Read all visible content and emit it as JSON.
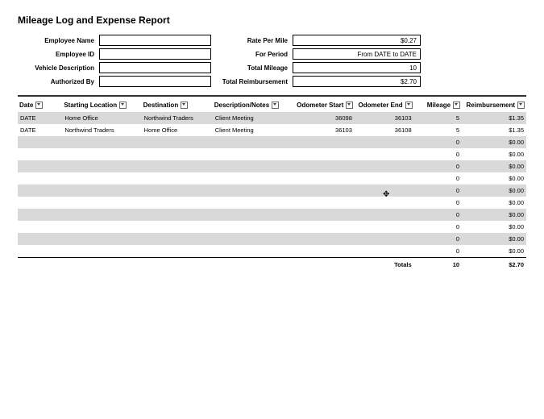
{
  "title": "Mileage Log and Expense Report",
  "header": {
    "left": [
      {
        "label": "Employee Name",
        "value": ""
      },
      {
        "label": "Employee ID",
        "value": ""
      },
      {
        "label": "Vehicle Description",
        "value": ""
      },
      {
        "label": "Authorized By",
        "value": ""
      }
    ],
    "right": [
      {
        "label": "Rate Per Mile",
        "value": "$0.27"
      },
      {
        "label": "For Period",
        "value": "From DATE to DATE"
      },
      {
        "label": "Total Mileage",
        "value": "10"
      },
      {
        "label": "Total Reimbursement",
        "value": "$2.70"
      }
    ]
  },
  "columns": [
    "Date",
    "Starting Location",
    "Destination",
    "Description/Notes",
    "Odometer Start",
    "Odometer End",
    "Mileage",
    "Reimbursement"
  ],
  "rows": [
    {
      "date": "DATE",
      "start": "Home Office",
      "dest": "Northwind Traders",
      "desc": "Client Meeting",
      "ostart": "36098",
      "oend": "36103",
      "mileage": "5",
      "reimb": "$1.35",
      "band": true
    },
    {
      "date": "DATE",
      "start": "Northwind Traders",
      "dest": "Home Office",
      "desc": "Client Meeting",
      "ostart": "36103",
      "oend": "36108",
      "mileage": "5",
      "reimb": "$1.35",
      "band": false
    },
    {
      "date": "",
      "start": "",
      "dest": "",
      "desc": "",
      "ostart": "",
      "oend": "",
      "mileage": "0",
      "reimb": "$0.00",
      "band": true
    },
    {
      "date": "",
      "start": "",
      "dest": "",
      "desc": "",
      "ostart": "",
      "oend": "",
      "mileage": "0",
      "reimb": "$0.00",
      "band": false
    },
    {
      "date": "",
      "start": "",
      "dest": "",
      "desc": "",
      "ostart": "",
      "oend": "",
      "mileage": "0",
      "reimb": "$0.00",
      "band": true
    },
    {
      "date": "",
      "start": "",
      "dest": "",
      "desc": "",
      "ostart": "",
      "oend": "",
      "mileage": "0",
      "reimb": "$0.00",
      "band": false
    },
    {
      "date": "",
      "start": "",
      "dest": "",
      "desc": "",
      "ostart": "",
      "oend": "",
      "mileage": "0",
      "reimb": "$0.00",
      "band": true
    },
    {
      "date": "",
      "start": "",
      "dest": "",
      "desc": "",
      "ostart": "",
      "oend": "",
      "mileage": "0",
      "reimb": "$0.00",
      "band": false
    },
    {
      "date": "",
      "start": "",
      "dest": "",
      "desc": "",
      "ostart": "",
      "oend": "",
      "mileage": "0",
      "reimb": "$0.00",
      "band": true
    },
    {
      "date": "",
      "start": "",
      "dest": "",
      "desc": "",
      "ostart": "",
      "oend": "",
      "mileage": "0",
      "reimb": "$0.00",
      "band": false
    },
    {
      "date": "",
      "start": "",
      "dest": "",
      "desc": "",
      "ostart": "",
      "oend": "",
      "mileage": "0",
      "reimb": "$0.00",
      "band": true
    },
    {
      "date": "",
      "start": "",
      "dest": "",
      "desc": "",
      "ostart": "",
      "oend": "",
      "mileage": "0",
      "reimb": "$0.00",
      "band": false
    }
  ],
  "totals": {
    "label": "Totals",
    "mileage": "10",
    "reimb": "$2.70"
  },
  "cursor_glyph": "✥"
}
